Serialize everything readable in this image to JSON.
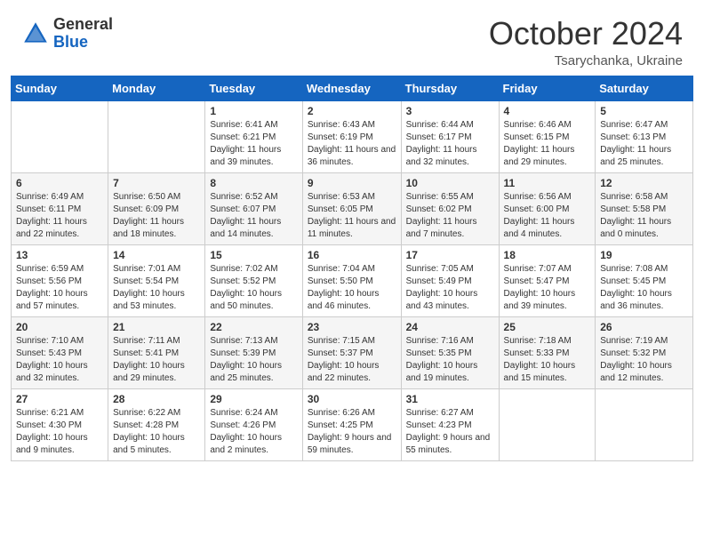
{
  "logo": {
    "general": "General",
    "blue": "Blue"
  },
  "header": {
    "month": "October 2024",
    "location": "Tsarychanka, Ukraine"
  },
  "days_of_week": [
    "Sunday",
    "Monday",
    "Tuesday",
    "Wednesday",
    "Thursday",
    "Friday",
    "Saturday"
  ],
  "weeks": [
    [
      {
        "day": "",
        "info": ""
      },
      {
        "day": "",
        "info": ""
      },
      {
        "day": "1",
        "info": "Sunrise: 6:41 AM\nSunset: 6:21 PM\nDaylight: 11 hours and 39 minutes."
      },
      {
        "day": "2",
        "info": "Sunrise: 6:43 AM\nSunset: 6:19 PM\nDaylight: 11 hours and 36 minutes."
      },
      {
        "day": "3",
        "info": "Sunrise: 6:44 AM\nSunset: 6:17 PM\nDaylight: 11 hours and 32 minutes."
      },
      {
        "day": "4",
        "info": "Sunrise: 6:46 AM\nSunset: 6:15 PM\nDaylight: 11 hours and 29 minutes."
      },
      {
        "day": "5",
        "info": "Sunrise: 6:47 AM\nSunset: 6:13 PM\nDaylight: 11 hours and 25 minutes."
      }
    ],
    [
      {
        "day": "6",
        "info": "Sunrise: 6:49 AM\nSunset: 6:11 PM\nDaylight: 11 hours and 22 minutes."
      },
      {
        "day": "7",
        "info": "Sunrise: 6:50 AM\nSunset: 6:09 PM\nDaylight: 11 hours and 18 minutes."
      },
      {
        "day": "8",
        "info": "Sunrise: 6:52 AM\nSunset: 6:07 PM\nDaylight: 11 hours and 14 minutes."
      },
      {
        "day": "9",
        "info": "Sunrise: 6:53 AM\nSunset: 6:05 PM\nDaylight: 11 hours and 11 minutes."
      },
      {
        "day": "10",
        "info": "Sunrise: 6:55 AM\nSunset: 6:02 PM\nDaylight: 11 hours and 7 minutes."
      },
      {
        "day": "11",
        "info": "Sunrise: 6:56 AM\nSunset: 6:00 PM\nDaylight: 11 hours and 4 minutes."
      },
      {
        "day": "12",
        "info": "Sunrise: 6:58 AM\nSunset: 5:58 PM\nDaylight: 11 hours and 0 minutes."
      }
    ],
    [
      {
        "day": "13",
        "info": "Sunrise: 6:59 AM\nSunset: 5:56 PM\nDaylight: 10 hours and 57 minutes."
      },
      {
        "day": "14",
        "info": "Sunrise: 7:01 AM\nSunset: 5:54 PM\nDaylight: 10 hours and 53 minutes."
      },
      {
        "day": "15",
        "info": "Sunrise: 7:02 AM\nSunset: 5:52 PM\nDaylight: 10 hours and 50 minutes."
      },
      {
        "day": "16",
        "info": "Sunrise: 7:04 AM\nSunset: 5:50 PM\nDaylight: 10 hours and 46 minutes."
      },
      {
        "day": "17",
        "info": "Sunrise: 7:05 AM\nSunset: 5:49 PM\nDaylight: 10 hours and 43 minutes."
      },
      {
        "day": "18",
        "info": "Sunrise: 7:07 AM\nSunset: 5:47 PM\nDaylight: 10 hours and 39 minutes."
      },
      {
        "day": "19",
        "info": "Sunrise: 7:08 AM\nSunset: 5:45 PM\nDaylight: 10 hours and 36 minutes."
      }
    ],
    [
      {
        "day": "20",
        "info": "Sunrise: 7:10 AM\nSunset: 5:43 PM\nDaylight: 10 hours and 32 minutes."
      },
      {
        "day": "21",
        "info": "Sunrise: 7:11 AM\nSunset: 5:41 PM\nDaylight: 10 hours and 29 minutes."
      },
      {
        "day": "22",
        "info": "Sunrise: 7:13 AM\nSunset: 5:39 PM\nDaylight: 10 hours and 25 minutes."
      },
      {
        "day": "23",
        "info": "Sunrise: 7:15 AM\nSunset: 5:37 PM\nDaylight: 10 hours and 22 minutes."
      },
      {
        "day": "24",
        "info": "Sunrise: 7:16 AM\nSunset: 5:35 PM\nDaylight: 10 hours and 19 minutes."
      },
      {
        "day": "25",
        "info": "Sunrise: 7:18 AM\nSunset: 5:33 PM\nDaylight: 10 hours and 15 minutes."
      },
      {
        "day": "26",
        "info": "Sunrise: 7:19 AM\nSunset: 5:32 PM\nDaylight: 10 hours and 12 minutes."
      }
    ],
    [
      {
        "day": "27",
        "info": "Sunrise: 6:21 AM\nSunset: 4:30 PM\nDaylight: 10 hours and 9 minutes."
      },
      {
        "day": "28",
        "info": "Sunrise: 6:22 AM\nSunset: 4:28 PM\nDaylight: 10 hours and 5 minutes."
      },
      {
        "day": "29",
        "info": "Sunrise: 6:24 AM\nSunset: 4:26 PM\nDaylight: 10 hours and 2 minutes."
      },
      {
        "day": "30",
        "info": "Sunrise: 6:26 AM\nSunset: 4:25 PM\nDaylight: 9 hours and 59 minutes."
      },
      {
        "day": "31",
        "info": "Sunrise: 6:27 AM\nSunset: 4:23 PM\nDaylight: 9 hours and 55 minutes."
      },
      {
        "day": "",
        "info": ""
      },
      {
        "day": "",
        "info": ""
      }
    ]
  ]
}
